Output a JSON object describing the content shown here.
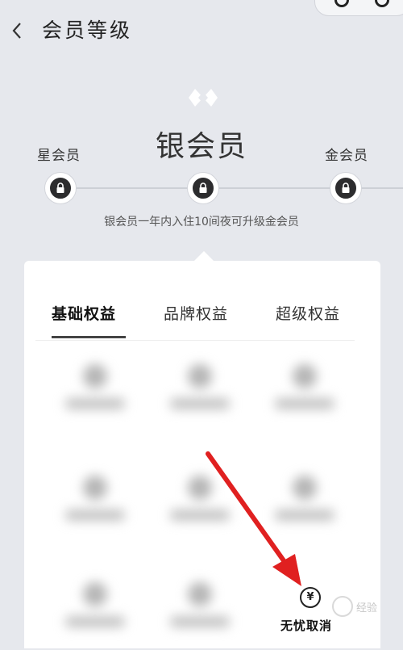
{
  "header": {
    "title": "会员等级",
    "back_icon": "chevron-left-icon"
  },
  "tiers": {
    "current": "银会员",
    "previous": "星会员",
    "next": "金会员",
    "hint": "银会员一年内入住10间夜可升级金会员",
    "node_icon": "lock-icon"
  },
  "tabs": [
    {
      "label": "基础权益",
      "active": true
    },
    {
      "label": "品牌权益",
      "active": false
    },
    {
      "label": "超级权益",
      "active": false
    }
  ],
  "benefits": {
    "visible_item": {
      "icon": "yen-icon",
      "icon_glyph": "¥",
      "label": "无忧取消"
    }
  },
  "colors": {
    "background": "#e6e8ed",
    "card": "#ffffff",
    "node": "#2c2c2e",
    "arrow": "#e02020"
  },
  "watermark": {
    "text": "经验"
  }
}
